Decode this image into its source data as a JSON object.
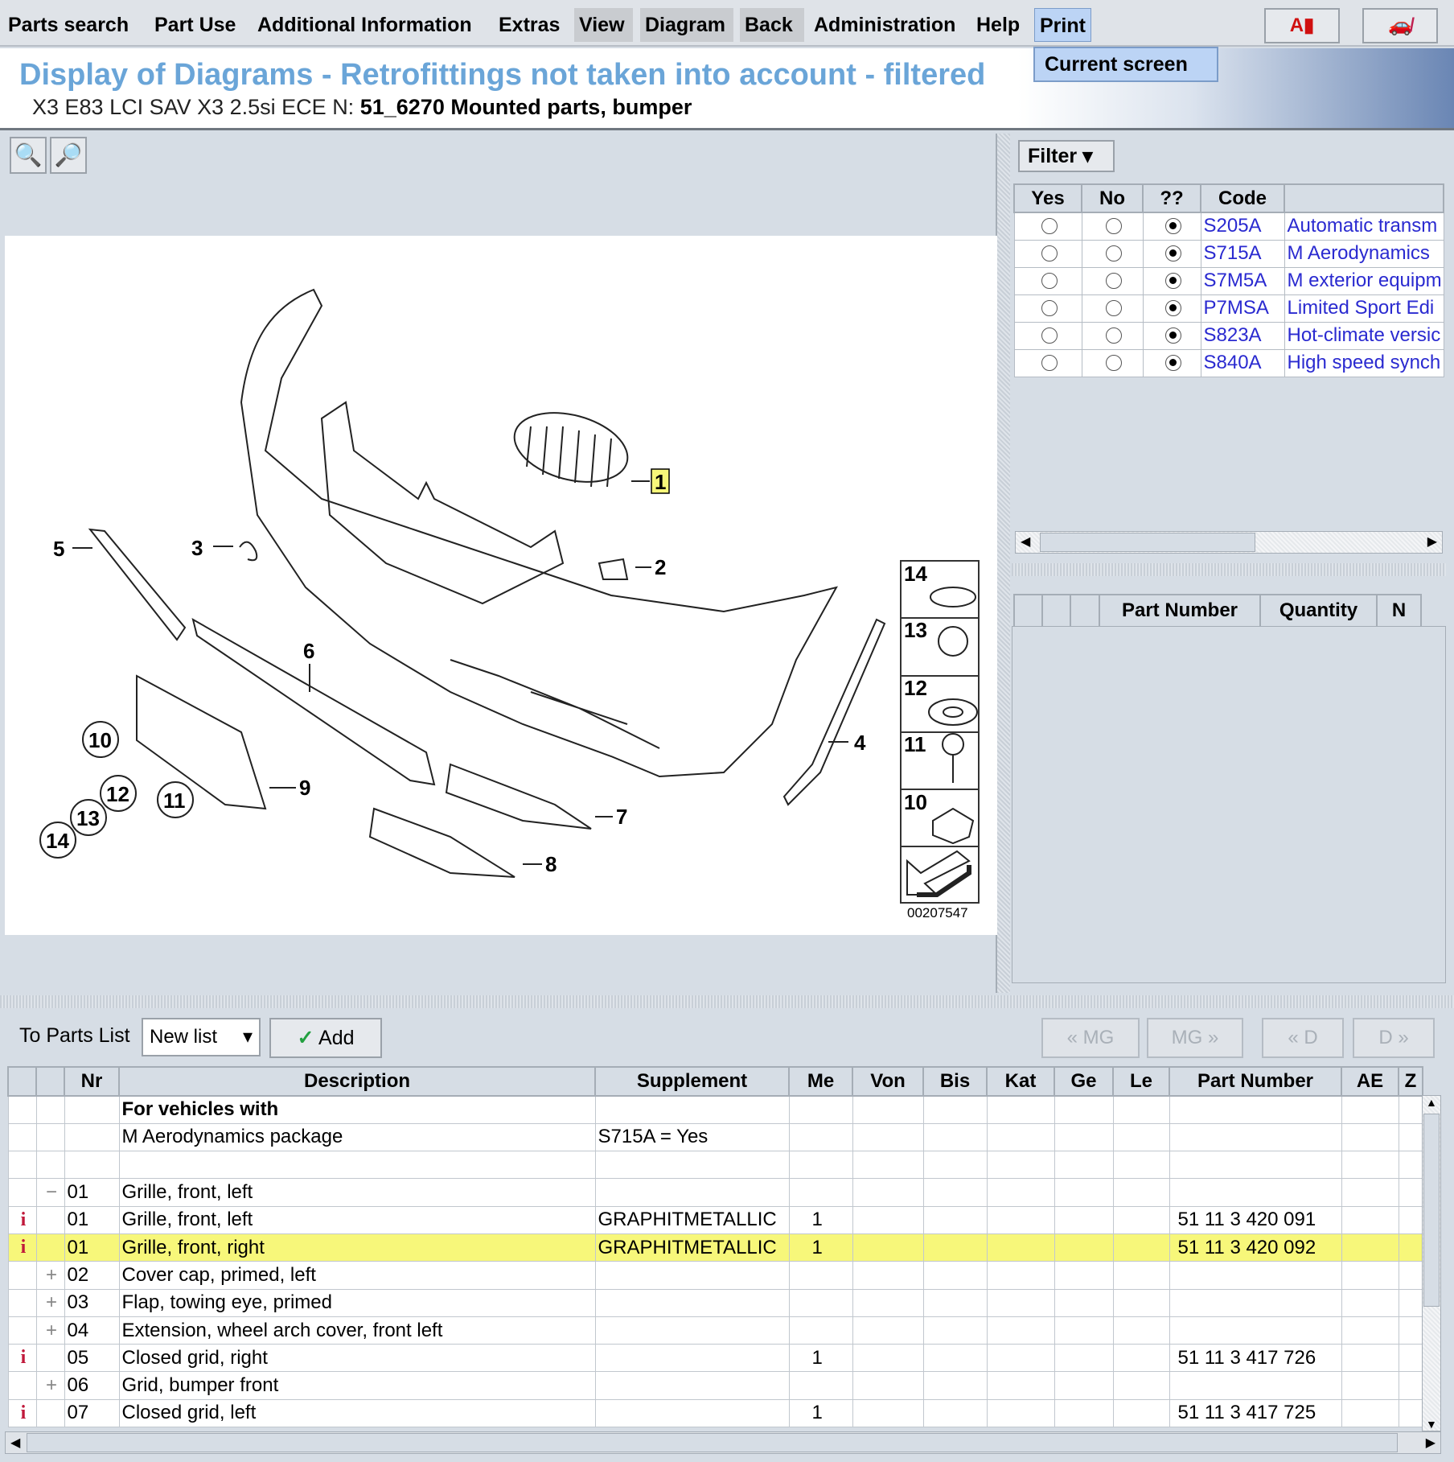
{
  "menu": {
    "items": [
      "Parts search",
      "Part Use",
      "Additional Information",
      "Extras",
      "View",
      "Diagram",
      "Back",
      "Administration",
      "Help",
      "Print"
    ],
    "dropdown": "Current screen",
    "tool_icons": [
      "pdf-icon",
      "car-crossed-icon"
    ]
  },
  "header": {
    "title": "Display of Diagrams - Retrofittings not taken into account - filtered",
    "vehicle": "X3 E83 LCI SAV X3 2.5si ECE  N:",
    "group": "51_6270 Mounted parts, bumper"
  },
  "diagram": {
    "zoom_in": "zoom-in-icon",
    "zoom_out": "zoom-out-icon",
    "image_number": "00207547",
    "callouts": [
      "1",
      "2",
      "3",
      "4",
      "5",
      "6",
      "7",
      "8",
      "9",
      "10",
      "11",
      "12",
      "13",
      "14"
    ],
    "legend_items": [
      "14",
      "13",
      "12",
      "11",
      "10"
    ],
    "highlight_color": "#f7f77a"
  },
  "filter": {
    "button": "Filter",
    "columns": [
      "Yes",
      "No",
      "??",
      "Code",
      ""
    ],
    "rows": [
      {
        "code": "S205A",
        "desc": "Automatic transm",
        "sel": "??"
      },
      {
        "code": "S715A",
        "desc": "M Aerodynamics",
        "sel": "??"
      },
      {
        "code": "S7M5A",
        "desc": "M exterior equipm",
        "sel": "??"
      },
      {
        "code": "P7MSA",
        "desc": "Limited Sport Edi",
        "sel": "??"
      },
      {
        "code": "S823A",
        "desc": "Hot-climate versic",
        "sel": "??"
      },
      {
        "code": "S840A",
        "desc": "High speed synch",
        "sel": "??"
      }
    ]
  },
  "partlist_panel": {
    "columns": [
      "",
      "",
      "",
      "Part Number",
      "Quantity",
      "N"
    ]
  },
  "toolbar": {
    "label": "To Parts List",
    "list_select": "New list",
    "add": "Add",
    "nav": [
      "« MG",
      "MG »",
      "« D",
      "D »"
    ]
  },
  "table": {
    "columns": [
      "",
      "",
      "Nr",
      "Description",
      "Supplement",
      "Me",
      "Von",
      "Bis",
      "Kat",
      "Ge",
      "Le",
      "Part Number",
      "AE",
      "Z"
    ],
    "rows": [
      {
        "icon": "",
        "exp": "",
        "nr": "",
        "desc": "For vehicles with",
        "bold": true,
        "supp": "",
        "me": "",
        "pn": ""
      },
      {
        "icon": "",
        "exp": "",
        "nr": "",
        "desc": "M Aerodynamics package",
        "supp": "S715A = Yes",
        "me": "",
        "pn": ""
      },
      {
        "icon": "",
        "exp": "",
        "nr": "",
        "desc": "",
        "supp": "",
        "me": "",
        "pn": ""
      },
      {
        "icon": "",
        "exp": "−",
        "nr": "01",
        "desc": "Grille, front, left",
        "supp": "",
        "me": "",
        "pn": ""
      },
      {
        "icon": "i",
        "exp": "",
        "nr": "01",
        "desc": "Grille, front, left",
        "supp": "GRAPHITMETALLIC",
        "me": "1",
        "pn": "51 11 3 420 091"
      },
      {
        "icon": "i",
        "exp": "",
        "nr": "01",
        "desc": "Grille, front, right",
        "supp": "GRAPHITMETALLIC",
        "me": "1",
        "pn": "51 11 3 420 092",
        "selected": true
      },
      {
        "icon": "",
        "exp": "+",
        "nr": "02",
        "desc": "Cover cap, primed, left",
        "supp": "",
        "me": "",
        "pn": ""
      },
      {
        "icon": "",
        "exp": "+",
        "nr": "03",
        "desc": "Flap, towing eye, primed",
        "supp": "",
        "me": "",
        "pn": ""
      },
      {
        "icon": "",
        "exp": "+",
        "nr": "04",
        "desc": "Extension, wheel arch cover, front left",
        "supp": "",
        "me": "",
        "pn": ""
      },
      {
        "icon": "i",
        "exp": "",
        "nr": "05",
        "desc": "Closed grid, right",
        "supp": "",
        "me": "1",
        "pn": "51 11 3 417 726"
      },
      {
        "icon": "",
        "exp": "+",
        "nr": "06",
        "desc": "Grid, bumper front",
        "supp": "",
        "me": "",
        "pn": ""
      },
      {
        "icon": "i",
        "exp": "",
        "nr": "07",
        "desc": "Closed grid, left",
        "supp": "",
        "me": "1",
        "pn": "51 11 3 417 725"
      }
    ]
  }
}
